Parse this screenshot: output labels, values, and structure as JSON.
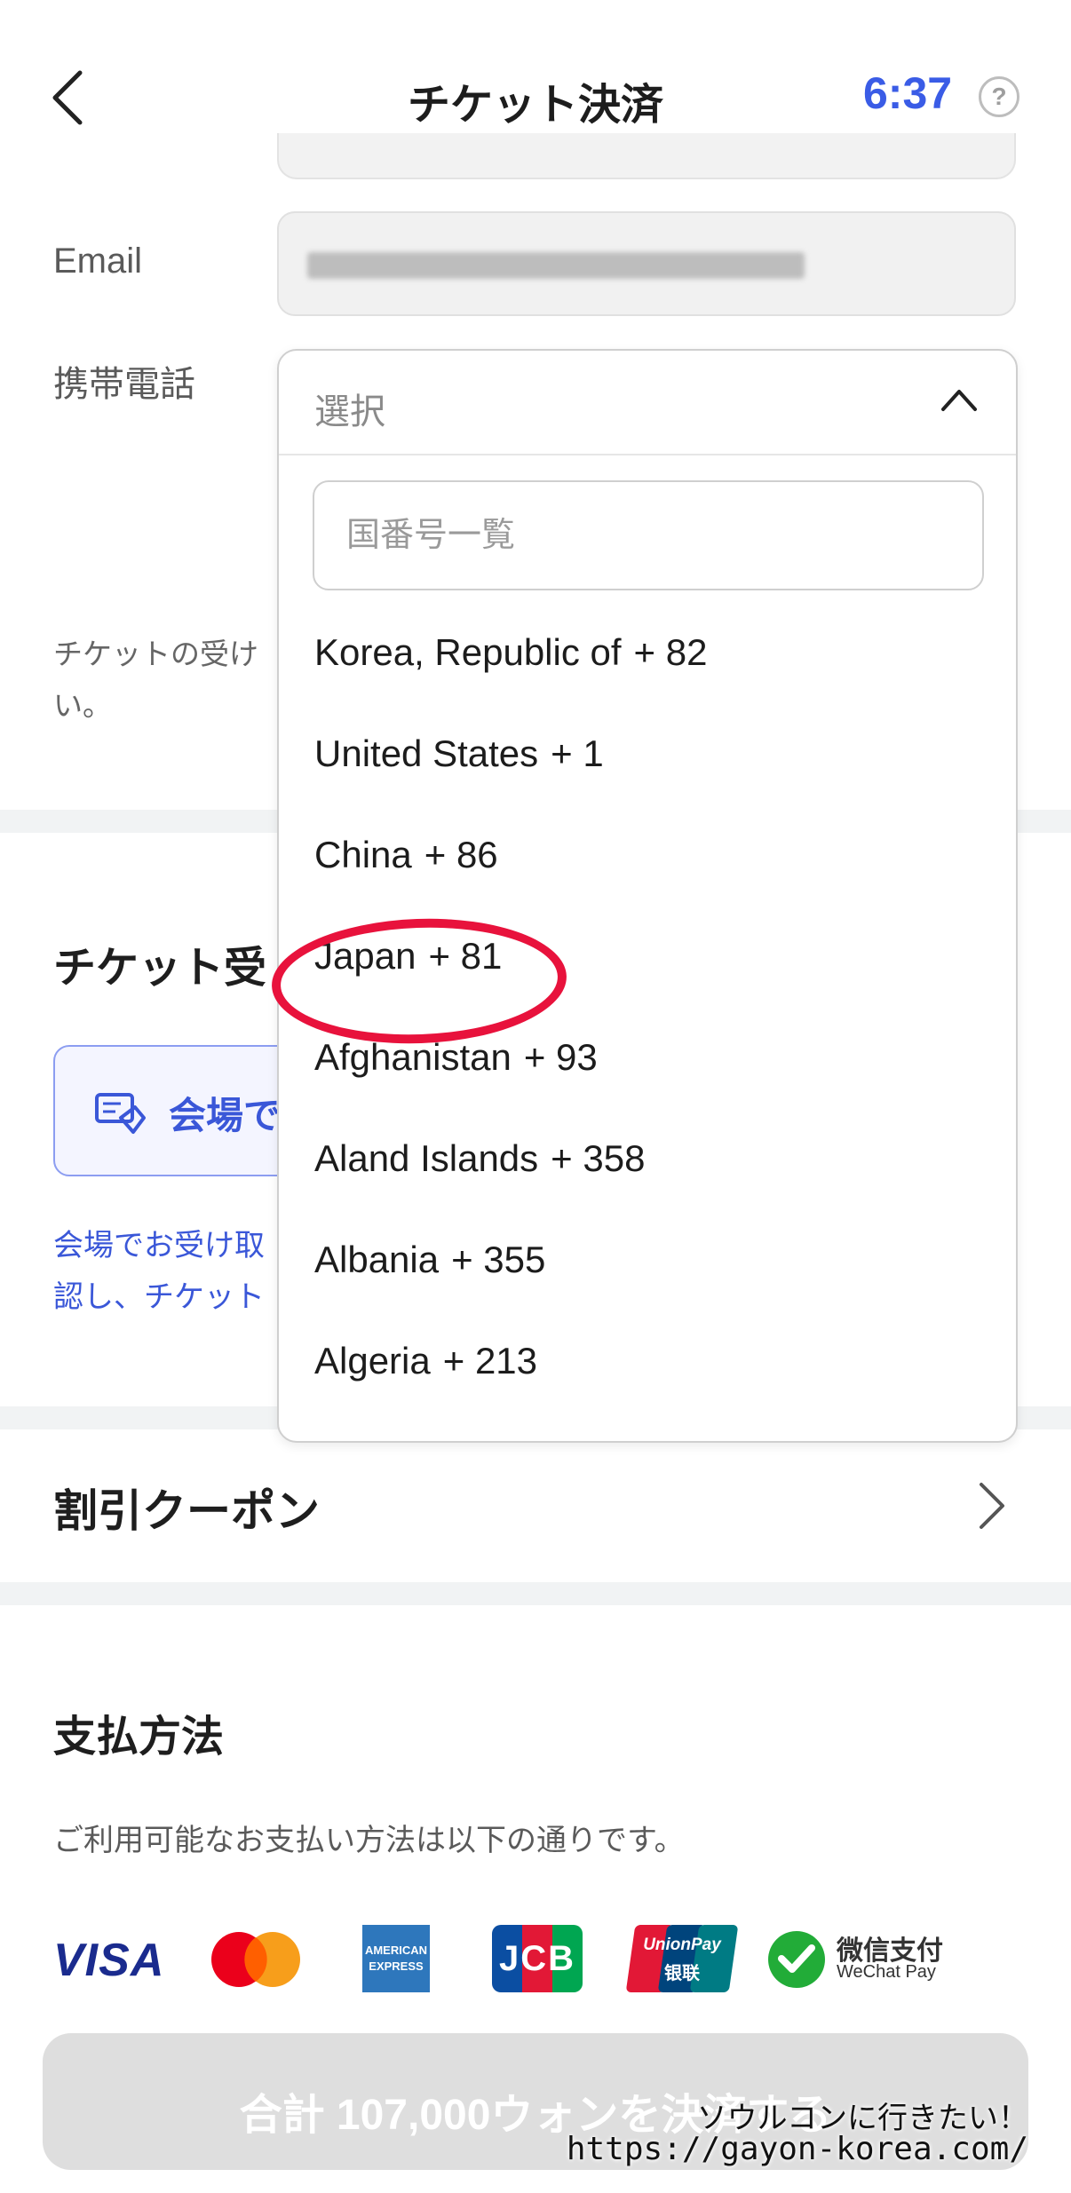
{
  "header": {
    "title": "チケット決済",
    "timer": "6:37",
    "help_symbol": "?"
  },
  "form": {
    "email_label": "Email",
    "phone_label": "携帯電話",
    "notice_line1": "チケットの受け",
    "notice_line2": "い。"
  },
  "dropdown": {
    "selected_placeholder": "選択",
    "search_placeholder": "国番号一覧",
    "items": [
      {
        "name": "Korea, Republic of",
        "code": "+ 82"
      },
      {
        "name": "United States",
        "code": "+ 1"
      },
      {
        "name": "China",
        "code": "+ 86"
      },
      {
        "name": "Japan",
        "code": "+ 81"
      },
      {
        "name": "Afghanistan",
        "code": "+ 93"
      },
      {
        "name": "Aland Islands",
        "code": "+ 358"
      },
      {
        "name": "Albania",
        "code": "+ 355"
      },
      {
        "name": "Algeria",
        "code": "+ 213"
      }
    ],
    "highlighted_item": "Japan"
  },
  "ticket_receive": {
    "title": "チケット受",
    "option_label": "会場で",
    "note_line1": "会場でお受け取",
    "note_line2": "認し、チケット"
  },
  "coupon": {
    "label": "割引クーポン"
  },
  "payment": {
    "title": "支払方法",
    "description": "ご利用可能なお支払い方法は以下の通りです。",
    "logos": {
      "visa": "VISA",
      "amex_line1": "AMERICAN",
      "amex_line2": "EXPRESS",
      "jcb": "JCB",
      "unionpay": "UnionPay",
      "unionpay_cn": "银联",
      "wechat_cn": "微信支付",
      "wechat_en": "WeChat Pay"
    },
    "pay_button_label": "合計 107,000ウォンを決済する"
  },
  "watermark": {
    "line1": "ソウルコンに行きたい！",
    "line2": "https://gayon-korea.com/"
  },
  "colors": {
    "accent": "#3a5ce6",
    "highlight": "#e8123c",
    "disabled_button": "#dedede"
  }
}
